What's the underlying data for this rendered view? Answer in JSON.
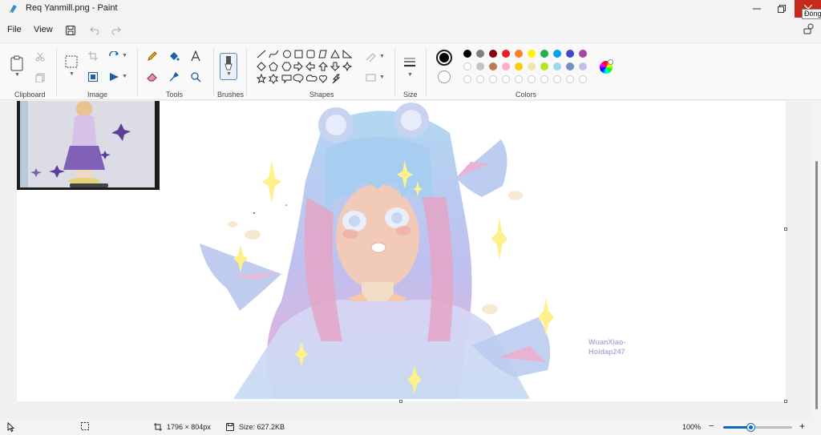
{
  "window": {
    "title": "Req Yanmill.png - Paint",
    "close_tooltip": "Đóng"
  },
  "menu": {
    "file": "File",
    "view": "View"
  },
  "ribbon": {
    "groups": {
      "clipboard": "Clipboard",
      "image": "Image",
      "tools": "Tools",
      "brushes": "Brushes",
      "shapes": "Shapes",
      "size": "Size",
      "colors": "Colors"
    },
    "palette_row1": [
      "#000000",
      "#7f7f7f",
      "#880015",
      "#ed1c24",
      "#ff7f27",
      "#fff200",
      "#22b14c",
      "#00a2e8",
      "#3f48cc",
      "#a349a4"
    ],
    "palette_row2": [
      "#ffffff",
      "#c3c3c3",
      "#b97a57",
      "#ffaec9",
      "#ffc90e",
      "#efe4b0",
      "#b5e61d",
      "#99d9ea",
      "#7092be",
      "#c8bfe7"
    ],
    "primary_color": "#000000",
    "secondary_color": "#ffffff"
  },
  "canvas": {
    "watermark_line1": "WuanXiao-",
    "watermark_line2": "Hoidap247"
  },
  "status": {
    "dimensions": "1796 × 804px",
    "size": "Size: 627.2KB",
    "zoom": "100%",
    "zoom_minus": "−",
    "zoom_plus": "+"
  }
}
